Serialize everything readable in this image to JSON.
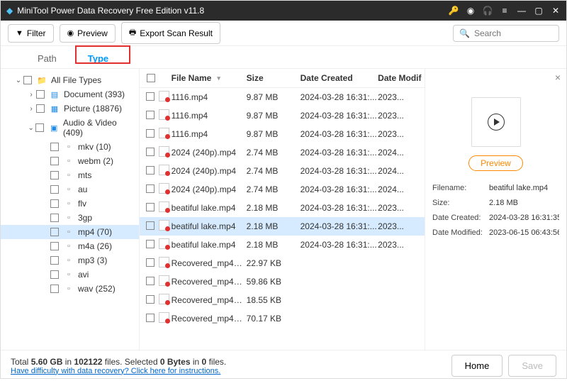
{
  "titlebar": {
    "title": "MiniTool Power Data Recovery Free Edition v11.8"
  },
  "toolbar": {
    "filter": "Filter",
    "preview": "Preview",
    "export": "Export Scan Result",
    "search_placeholder": "Search"
  },
  "tabs": {
    "path": "Path",
    "type": "Type"
  },
  "tree": {
    "root": "All File Types",
    "doc": "Document (393)",
    "pic": "Picture (18876)",
    "av": "Audio & Video (409)",
    "ext": {
      "mkv": "mkv (10)",
      "webm": "webm (2)",
      "mts": "mts",
      "au": "au",
      "flv": "flv",
      "3gp": "3gp",
      "mp4": "mp4 (70)",
      "m4a": "m4a (26)",
      "mp3": "mp3 (3)",
      "avi": "avi",
      "wav": "wav (252)"
    }
  },
  "columns": {
    "name": "File Name",
    "size": "Size",
    "created": "Date Created",
    "modified": "Date Modif"
  },
  "files": [
    {
      "name": "1116.mp4",
      "size": "9.87 MB",
      "created": "2024-03-28 16:31:...",
      "modified": "2023..."
    },
    {
      "name": "1116.mp4",
      "size": "9.87 MB",
      "created": "2024-03-28 16:31:...",
      "modified": "2023..."
    },
    {
      "name": "1116.mp4",
      "size": "9.87 MB",
      "created": "2024-03-28 16:31:...",
      "modified": "2023..."
    },
    {
      "name": "2024 (240p).mp4",
      "size": "2.74 MB",
      "created": "2024-03-28 16:31:...",
      "modified": "2024..."
    },
    {
      "name": "2024 (240p).mp4",
      "size": "2.74 MB",
      "created": "2024-03-28 16:31:...",
      "modified": "2024..."
    },
    {
      "name": "2024 (240p).mp4",
      "size": "2.74 MB",
      "created": "2024-03-28 16:31:...",
      "modified": "2024..."
    },
    {
      "name": "beatiful lake.mp4",
      "size": "2.18 MB",
      "created": "2024-03-28 16:31:...",
      "modified": "2023..."
    },
    {
      "name": "beatiful lake.mp4",
      "size": "2.18 MB",
      "created": "2024-03-28 16:31:...",
      "modified": "2023...",
      "selected": true
    },
    {
      "name": "beatiful lake.mp4",
      "size": "2.18 MB",
      "created": "2024-03-28 16:31:...",
      "modified": "2023..."
    },
    {
      "name": "Recovered_mp4_f...",
      "size": "22.97 KB",
      "created": "",
      "modified": ""
    },
    {
      "name": "Recovered_mp4_f...",
      "size": "59.86 KB",
      "created": "",
      "modified": ""
    },
    {
      "name": "Recovered_mp4_f...",
      "size": "18.55 KB",
      "created": "",
      "modified": ""
    },
    {
      "name": "Recovered_mp4_f...",
      "size": "70.17 KB",
      "created": "",
      "modified": ""
    }
  ],
  "preview": {
    "button": "Preview",
    "labels": {
      "filename": "Filename:",
      "size": "Size:",
      "created": "Date Created:",
      "modified": "Date Modified:"
    },
    "values": {
      "filename": "beatiful lake.mp4",
      "size": "2.18 MB",
      "created": "2024-03-28 16:31:35",
      "modified": "2023-06-15 06:43:56"
    }
  },
  "status": {
    "line1a": "Total ",
    "total_size": "5.60 GB",
    "line1b": " in ",
    "total_files": "102122",
    "line1c": " files.   Selected ",
    "sel_bytes": "0 Bytes",
    "line1d": " in ",
    "sel_files": "0",
    "line1e": " files.",
    "help": "Have difficulty with data recovery? Click here for instructions.",
    "home": "Home",
    "save": "Save"
  }
}
